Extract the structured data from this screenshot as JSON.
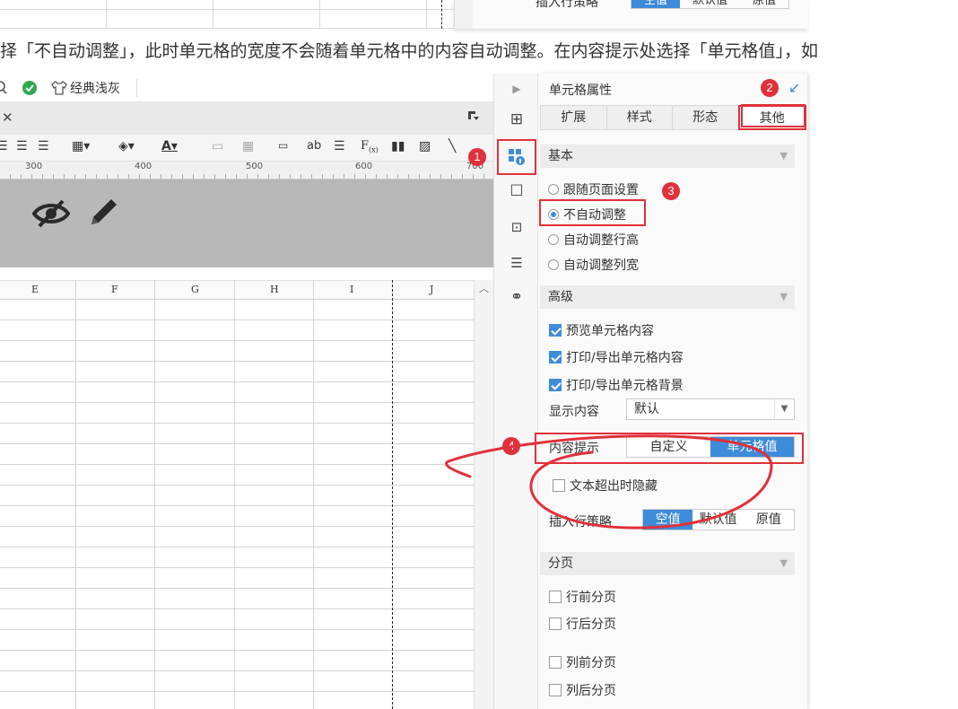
{
  "prev": {
    "label": "插入行策略",
    "options": [
      "空值",
      "默认值",
      "原值"
    ],
    "selected": "空值"
  },
  "caption": "择「不自动调整」，此时单元格的宽度不会随着单元格中的内容自动调整。在内容提示处选择「单元格值」，如",
  "toolbar": {
    "theme_label": "经典浅灰"
  },
  "ruler": [
    "300",
    "400",
    "500",
    "600",
    "700"
  ],
  "columns": [
    "E",
    "F",
    "G",
    "H",
    "I",
    "J"
  ],
  "panel": {
    "title": "单元格属性",
    "tabs": [
      "扩展",
      "样式",
      "形态",
      "其他"
    ],
    "active_tab": "其他",
    "basic": {
      "title": "基本",
      "options": [
        "跟随页面设置",
        "不自动调整",
        "自动调整行高",
        "自动调整列宽"
      ],
      "selected": "不自动调整"
    },
    "advanced": {
      "title": "高级",
      "checks": [
        "预览单元格内容",
        "打印/导出单元格内容",
        "打印/导出单元格背景"
      ],
      "display_label": "显示内容",
      "display_value": "默认",
      "tip_label": "内容提示",
      "tip_options": [
        "自定义",
        "单元格值"
      ],
      "tip_selected": "单元格值",
      "overflow_label": "文本超出时隐藏",
      "insert_label": "插入行策略",
      "insert_options": [
        "空值",
        "默认值",
        "原值"
      ],
      "insert_selected": "空值"
    },
    "paging": {
      "title": "分页",
      "checks": [
        "行前分页",
        "行后分页",
        "列前分页",
        "列后分页"
      ]
    }
  },
  "badges": [
    "1",
    "2",
    "3",
    "4"
  ],
  "colors": {
    "accent": "#3d8bd9",
    "highlight": "#e0313a"
  }
}
